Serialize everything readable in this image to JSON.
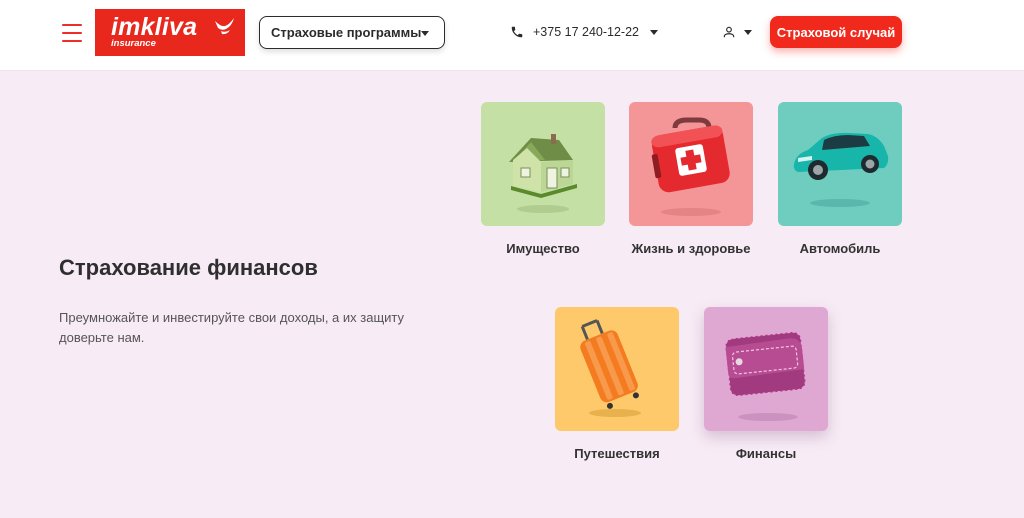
{
  "header": {
    "menu_icon": "hamburger-icon",
    "logo": {
      "word": "imkliva",
      "sub": "insurance",
      "bg_color": "#e8281d"
    },
    "programs_label": "Страховые программы",
    "phone": {
      "icon": "phone-icon",
      "number": "+375 17 240-12-22"
    },
    "user_icon": "user-icon",
    "claim_label": "Страховой случай"
  },
  "main": {
    "title": "Страхование финансов",
    "description": "Преумножайте и инвестируйте свои доходы, а их защиту доверьте нам."
  },
  "cards": [
    {
      "label": "Имущество",
      "color": "#c5e0a5",
      "icon": "house-icon"
    },
    {
      "label": "Жизнь и здоровье",
      "color": "#f49698",
      "icon": "first-aid-kit-icon"
    },
    {
      "label": "Автомобиль",
      "color": "#6fcdc0",
      "icon": "car-icon"
    },
    {
      "label": "Путешествия",
      "color": "#fdc96a",
      "icon": "suitcase-icon"
    },
    {
      "label": "Финансы",
      "color": "#dfa8d3",
      "icon": "wallet-icon",
      "selected": true
    }
  ],
  "colors": {
    "accent": "#f0291c",
    "page_bg": "#f7ebf5"
  }
}
